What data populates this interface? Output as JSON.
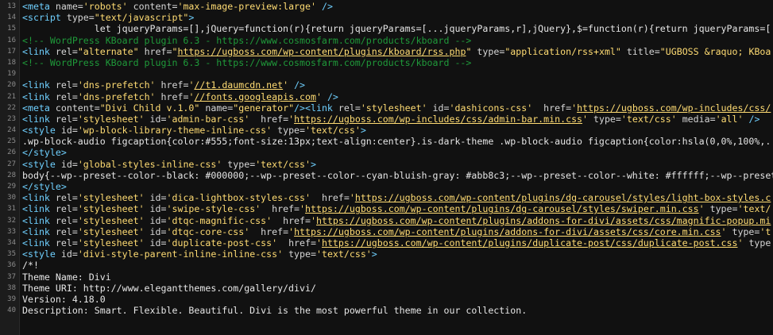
{
  "window": {
    "type": "view-source"
  },
  "colors": {
    "background": "#111111",
    "gutter_bg": "#1c1c1c",
    "line_number": "#8c8c8c",
    "tag": "#6fd0ff",
    "attribute": "#d6d6d6",
    "string": "#ffdc73",
    "comment": "#1f9a3a",
    "text": "#e6e6e6"
  },
  "lines": [
    {
      "num": "13",
      "tokens": [
        {
          "t": "tag",
          "v": "<meta "
        },
        {
          "t": "attr",
          "v": "name="
        },
        {
          "t": "str",
          "v": "'robots'"
        },
        {
          "t": "attr",
          "v": " content="
        },
        {
          "t": "str",
          "v": "'max-image-preview:large'"
        },
        {
          "t": "tag",
          "v": " />"
        }
      ]
    },
    {
      "num": "14",
      "tokens": [
        {
          "t": "tag",
          "v": "<script "
        },
        {
          "t": "attr",
          "v": "type="
        },
        {
          "t": "str",
          "v": "\"text/javascript\""
        },
        {
          "t": "tag",
          "v": ">"
        }
      ]
    },
    {
      "num": "15",
      "tokens": [
        {
          "t": "txt",
          "v": "             let jqueryParams=[],jQuery=function(r){return jqueryParams=[...jqueryParams,r],jQuery},$=function(r){return jqueryParams=[..."
        }
      ]
    },
    {
      "num": "16",
      "tokens": [
        {
          "t": "com",
          "v": "<!-- WordPress KBoard plugin 6.3 - https://www.cosmosfarm.com/products/kboard -->"
        }
      ]
    },
    {
      "num": "17",
      "tokens": [
        {
          "t": "tag",
          "v": "<link "
        },
        {
          "t": "attr",
          "v": "rel="
        },
        {
          "t": "str",
          "v": "\"alternate\""
        },
        {
          "t": "attr",
          "v": " href="
        },
        {
          "t": "str",
          "v": "\""
        },
        {
          "t": "url",
          "v": "https://ugboss.com/wp-content/plugins/kboard/rss.php"
        },
        {
          "t": "str",
          "v": "\""
        },
        {
          "t": "attr",
          "v": " type="
        },
        {
          "t": "str",
          "v": "\"application/rss+xml\""
        },
        {
          "t": "attr",
          "v": " title="
        },
        {
          "t": "str",
          "v": "\"UGBOSS &raquo; KBoa"
        }
      ]
    },
    {
      "num": "18",
      "tokens": [
        {
          "t": "com",
          "v": "<!-- WordPress KBoard plugin 6.3 - https://www.cosmosfarm.com/products/kboard -->"
        }
      ]
    },
    {
      "num": "19",
      "tokens": []
    },
    {
      "num": "20",
      "tokens": [
        {
          "t": "tag",
          "v": "<link "
        },
        {
          "t": "attr",
          "v": "rel="
        },
        {
          "t": "str",
          "v": "'dns-prefetch'"
        },
        {
          "t": "attr",
          "v": " href="
        },
        {
          "t": "str",
          "v": "'"
        },
        {
          "t": "url",
          "v": "//t1.daumcdn.net"
        },
        {
          "t": "str",
          "v": "'"
        },
        {
          "t": "tag",
          "v": " />"
        }
      ]
    },
    {
      "num": "21",
      "tokens": [
        {
          "t": "tag",
          "v": "<link "
        },
        {
          "t": "attr",
          "v": "rel="
        },
        {
          "t": "str",
          "v": "'dns-prefetch'"
        },
        {
          "t": "attr",
          "v": " href="
        },
        {
          "t": "str",
          "v": "'"
        },
        {
          "t": "url",
          "v": "//fonts.googleapis.com"
        },
        {
          "t": "str",
          "v": "'"
        },
        {
          "t": "tag",
          "v": " />"
        }
      ]
    },
    {
      "num": "22",
      "tokens": [
        {
          "t": "tag",
          "v": "<meta "
        },
        {
          "t": "attr",
          "v": "content="
        },
        {
          "t": "str",
          "v": "\"Divi Child v.1.0\""
        },
        {
          "t": "attr",
          "v": " name="
        },
        {
          "t": "str",
          "v": "\"generator\""
        },
        {
          "t": "tag",
          "v": "/><link "
        },
        {
          "t": "attr",
          "v": "rel="
        },
        {
          "t": "str",
          "v": "'stylesheet'"
        },
        {
          "t": "attr",
          "v": " id="
        },
        {
          "t": "str",
          "v": "'dashicons-css'"
        },
        {
          "t": "attr",
          "v": "  href="
        },
        {
          "t": "str",
          "v": "'"
        },
        {
          "t": "url",
          "v": "https://ugboss.com/wp-includes/css/"
        }
      ]
    },
    {
      "num": "23",
      "tokens": [
        {
          "t": "tag",
          "v": "<link "
        },
        {
          "t": "attr",
          "v": "rel="
        },
        {
          "t": "str",
          "v": "'stylesheet'"
        },
        {
          "t": "attr",
          "v": " id="
        },
        {
          "t": "str",
          "v": "'admin-bar-css'"
        },
        {
          "t": "attr",
          "v": "  href="
        },
        {
          "t": "str",
          "v": "'"
        },
        {
          "t": "url",
          "v": "https://ugboss.com/wp-includes/css/admin-bar.min.css"
        },
        {
          "t": "str",
          "v": "'"
        },
        {
          "t": "attr",
          "v": " type="
        },
        {
          "t": "str",
          "v": "'text/css'"
        },
        {
          "t": "attr",
          "v": " media="
        },
        {
          "t": "str",
          "v": "'all'"
        },
        {
          "t": "tag",
          "v": " />"
        }
      ]
    },
    {
      "num": "24",
      "tokens": [
        {
          "t": "tag",
          "v": "<style "
        },
        {
          "t": "attr",
          "v": "id="
        },
        {
          "t": "str",
          "v": "'wp-block-library-theme-inline-css'"
        },
        {
          "t": "attr",
          "v": " type="
        },
        {
          "t": "str",
          "v": "'text/css'"
        },
        {
          "t": "tag",
          "v": ">"
        }
      ]
    },
    {
      "num": "25",
      "tokens": [
        {
          "t": "txt",
          "v": ".wp-block-audio figcaption{color:#555;font-size:13px;text-align:center}.is-dark-theme .wp-block-audio figcaption{color:hsla(0,0%,100%,..."
        }
      ]
    },
    {
      "num": "26",
      "tokens": [
        {
          "t": "tag",
          "v": "</style>"
        }
      ]
    },
    {
      "num": "27",
      "tokens": [
        {
          "t": "tag",
          "v": "<style "
        },
        {
          "t": "attr",
          "v": "id="
        },
        {
          "t": "str",
          "v": "'global-styles-inline-css'"
        },
        {
          "t": "attr",
          "v": " type="
        },
        {
          "t": "str",
          "v": "'text/css'"
        },
        {
          "t": "tag",
          "v": ">"
        }
      ]
    },
    {
      "num": "28",
      "tokens": [
        {
          "t": "txt",
          "v": "body{--wp--preset--color--black: #000000;--wp--preset--color--cyan-bluish-gray: #abb8c3;--wp--preset--color--white: #ffffff;--wp--preset"
        }
      ]
    },
    {
      "num": "29",
      "tokens": [
        {
          "t": "tag",
          "v": "</style>"
        }
      ]
    },
    {
      "num": "30",
      "tokens": [
        {
          "t": "tag",
          "v": "<link "
        },
        {
          "t": "attr",
          "v": "rel="
        },
        {
          "t": "str",
          "v": "'stylesheet'"
        },
        {
          "t": "attr",
          "v": " id="
        },
        {
          "t": "str",
          "v": "'dica-lightbox-styles-css'"
        },
        {
          "t": "attr",
          "v": "  href="
        },
        {
          "t": "str",
          "v": "'"
        },
        {
          "t": "url",
          "v": "https://ugboss.com/wp-content/plugins/dg-carousel/styles/light-box-styles.c"
        }
      ]
    },
    {
      "num": "31",
      "tokens": [
        {
          "t": "tag",
          "v": "<link "
        },
        {
          "t": "attr",
          "v": "rel="
        },
        {
          "t": "str",
          "v": "'stylesheet'"
        },
        {
          "t": "attr",
          "v": " id="
        },
        {
          "t": "str",
          "v": "'swipe-style-css'"
        },
        {
          "t": "attr",
          "v": "  href="
        },
        {
          "t": "str",
          "v": "'"
        },
        {
          "t": "url",
          "v": "https://ugboss.com/wp-content/plugins/dg-carousel/styles/swiper.min.css"
        },
        {
          "t": "str",
          "v": "'"
        },
        {
          "t": "attr",
          "v": " type="
        },
        {
          "t": "str",
          "v": "'text/"
        }
      ]
    },
    {
      "num": "32",
      "tokens": [
        {
          "t": "tag",
          "v": "<link "
        },
        {
          "t": "attr",
          "v": "rel="
        },
        {
          "t": "str",
          "v": "'stylesheet'"
        },
        {
          "t": "attr",
          "v": " id="
        },
        {
          "t": "str",
          "v": "'dtqc-magnific-css'"
        },
        {
          "t": "attr",
          "v": "  href="
        },
        {
          "t": "str",
          "v": "'"
        },
        {
          "t": "url",
          "v": "https://ugboss.com/wp-content/plugins/addons-for-divi/assets/css/magnific-popup.mi"
        }
      ]
    },
    {
      "num": "33",
      "tokens": [
        {
          "t": "tag",
          "v": "<link "
        },
        {
          "t": "attr",
          "v": "rel="
        },
        {
          "t": "str",
          "v": "'stylesheet'"
        },
        {
          "t": "attr",
          "v": " id="
        },
        {
          "t": "str",
          "v": "'dtqc-core-css'"
        },
        {
          "t": "attr",
          "v": "  href="
        },
        {
          "t": "str",
          "v": "'"
        },
        {
          "t": "url",
          "v": "https://ugboss.com/wp-content/plugins/addons-for-divi/assets/css/core.min.css"
        },
        {
          "t": "str",
          "v": "'"
        },
        {
          "t": "attr",
          "v": " type="
        },
        {
          "t": "str",
          "v": "'t"
        }
      ]
    },
    {
      "num": "34",
      "tokens": [
        {
          "t": "tag",
          "v": "<link "
        },
        {
          "t": "attr",
          "v": "rel="
        },
        {
          "t": "str",
          "v": "'stylesheet'"
        },
        {
          "t": "attr",
          "v": " id="
        },
        {
          "t": "str",
          "v": "'duplicate-post-css'"
        },
        {
          "t": "attr",
          "v": "  href="
        },
        {
          "t": "str",
          "v": "'"
        },
        {
          "t": "url",
          "v": "https://ugboss.com/wp-content/plugins/duplicate-post/css/duplicate-post.css"
        },
        {
          "t": "str",
          "v": "'"
        },
        {
          "t": "attr",
          "v": " type"
        }
      ]
    },
    {
      "num": "35",
      "tokens": [
        {
          "t": "tag",
          "v": "<style "
        },
        {
          "t": "attr",
          "v": "id="
        },
        {
          "t": "str",
          "v": "'divi-style-parent-inline-inline-css'"
        },
        {
          "t": "attr",
          "v": " type="
        },
        {
          "t": "str",
          "v": "'text/css'"
        },
        {
          "t": "tag",
          "v": ">"
        }
      ]
    },
    {
      "num": "36",
      "tokens": [
        {
          "t": "txt",
          "v": "/*!"
        }
      ]
    },
    {
      "num": "37",
      "tokens": [
        {
          "t": "txt",
          "v": "Theme Name: Divi"
        }
      ]
    },
    {
      "num": "38",
      "tokens": [
        {
          "t": "txt",
          "v": "Theme URI: http://www.elegantthemes.com/gallery/divi/"
        }
      ]
    },
    {
      "num": "39",
      "tokens": [
        {
          "t": "txt",
          "v": "Version: 4.18.0"
        }
      ]
    },
    {
      "num": "40",
      "tokens": [
        {
          "t": "txt",
          "v": "Description: Smart. Flexible. Beautiful. Divi is the most powerful theme in our collection."
        }
      ]
    }
  ]
}
